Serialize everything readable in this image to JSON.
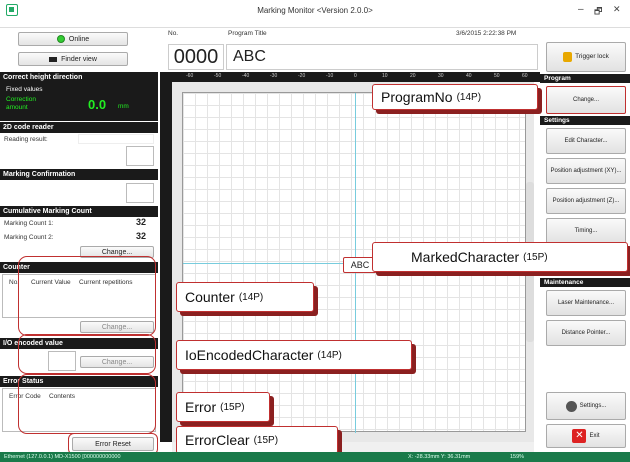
{
  "window": {
    "title": "Marking Monitor <Version 2.0.0>",
    "min": "–",
    "max": "🗗",
    "close": "✕"
  },
  "left": {
    "online": "Online",
    "finder_view": "Finder view",
    "correct_height": {
      "header": "Correct height direction",
      "fixed": "Fixed values",
      "correction_label": "Correction amount",
      "value": "0.0",
      "unit": "mm"
    },
    "code_reader": {
      "header": "2D code reader",
      "reading": "Reading result:"
    },
    "marking_confirmation": {
      "header": "Marking Confirmation"
    },
    "cumulative": {
      "header": "Cumulative Marking Count",
      "count1_label": "Marking Count 1:",
      "count1": "32",
      "count2_label": "Marking Count 2:",
      "count2": "32",
      "change": "Change..."
    },
    "counter": {
      "header": "Counter",
      "cols": [
        "No.",
        "Current Value",
        "Current repetitions"
      ],
      "change": "Change..."
    },
    "io": {
      "header": "I/O encoded value",
      "change": "Change..."
    },
    "error": {
      "header": "Error Status",
      "cols": [
        "Error Code",
        "Contents"
      ],
      "reset": "Error Reset"
    }
  },
  "top": {
    "no_label": "No.",
    "program_title_label": "Program Title",
    "no": "0000",
    "title": "ABC",
    "datetime": "3/6/2015 2:22:38 PM",
    "trigger_lock": "Trigger lock"
  },
  "canvas": {
    "marked_text": "ABC",
    "ruler_ticks": [
      "-60",
      "-50",
      "-40",
      "-30",
      "-20",
      "-10",
      "0",
      "10",
      "20",
      "30",
      "40",
      "50",
      "60"
    ]
  },
  "right": {
    "program_header": "Program",
    "change": "Change...",
    "settings_header": "Settings",
    "edit_character": "Edit Character...",
    "pos_xy": "Position adjustment (XY)...",
    "pos_z": "Position adjustment (Z)...",
    "timing": "Timing...",
    "maintenance_header": "Maintenance",
    "laser_maintenance": "Laser Maintenance...",
    "distance_pointer": "Distance Pointer...",
    "settings": "Settings...",
    "exit": "Exit"
  },
  "callouts": {
    "program_no": "ProgramNo",
    "program_no_pt": "(14P)",
    "marked_char": "MarkedCharacter",
    "marked_char_pt": "(15P)",
    "counter": "Counter",
    "counter_pt": "(14P)",
    "io": "IoEncodedCharacter",
    "io_pt": "(14P)",
    "error": "Error",
    "error_pt": "(15P)",
    "error_clear": "ErrorClear",
    "error_clear_pt": "(15P)"
  },
  "status": {
    "connection": "Ethernet (127.0.0.1)  MD-X1500 [000000000000",
    "coords": "X: -28.33mm Y: 36.31mm",
    "zoom": "159%"
  },
  "colors": {
    "accent_red": "#c03030",
    "status_green": "#1a7a4a"
  }
}
